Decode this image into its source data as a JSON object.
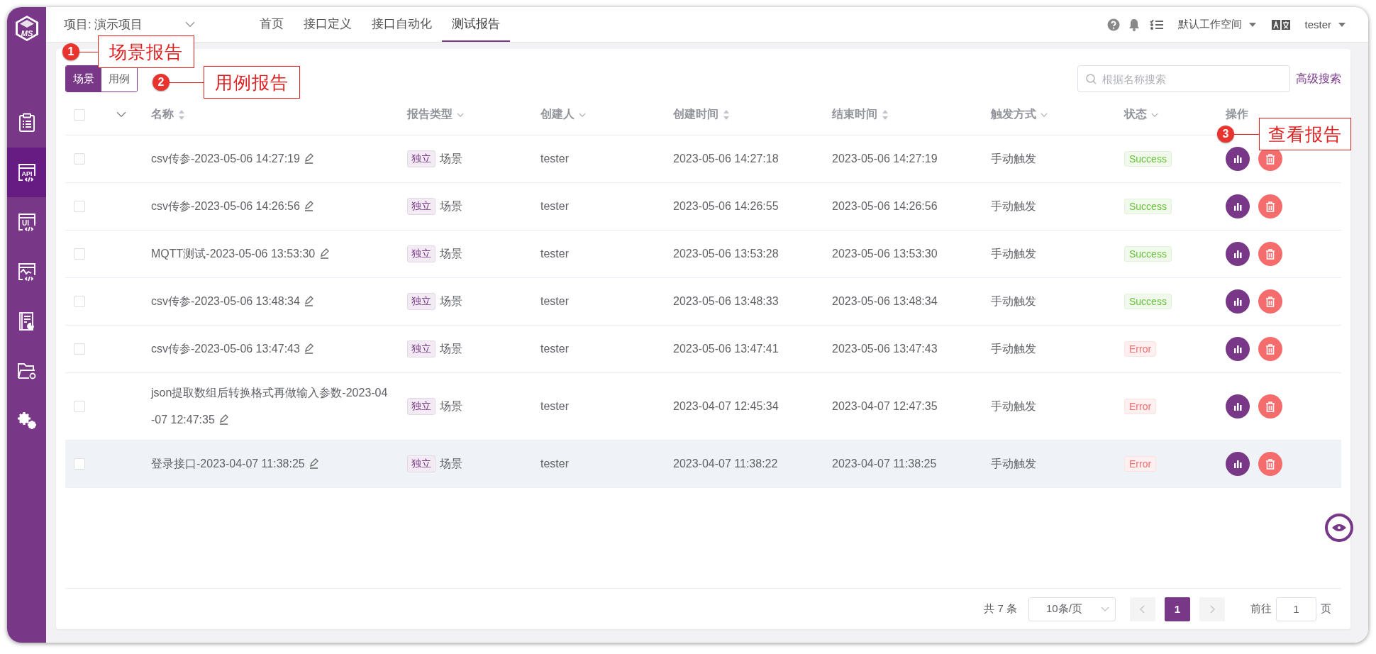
{
  "logo": {
    "text": "MS"
  },
  "sidebar": {
    "items": [
      {
        "kind": "case",
        "selected": false
      },
      {
        "kind": "api",
        "label": "API",
        "selected": true
      },
      {
        "kind": "ui",
        "label": "UI",
        "selected": false
      },
      {
        "kind": "performance",
        "selected": false
      },
      {
        "kind": "report",
        "selected": false
      },
      {
        "kind": "project",
        "selected": false
      },
      {
        "kind": "settings",
        "selected": false
      }
    ]
  },
  "header": {
    "project": "项目: 演示项目",
    "nav": [
      {
        "label": "首页",
        "selected": false
      },
      {
        "label": "接口定义",
        "selected": false
      },
      {
        "label": "接口自动化",
        "selected": false
      },
      {
        "label": "测试报告",
        "selected": true
      }
    ],
    "workspace": "默认工作空间",
    "user": "tester"
  },
  "toolbar": {
    "toggle": [
      {
        "label": "场景",
        "selected": true
      },
      {
        "label": "用例",
        "selected": false
      }
    ],
    "search": {
      "placeholder": "根据名称搜索"
    },
    "advanced_search": "高级搜索"
  },
  "table": {
    "select_all": {
      "checked": false
    },
    "columns": [
      {
        "label": "名称",
        "sortable": true,
        "filterable": false
      },
      {
        "label": "报告类型",
        "sortable": false,
        "filterable": true
      },
      {
        "label": "创建人",
        "sortable": false,
        "filterable": true
      },
      {
        "label": "创建时间",
        "sortable": true,
        "filterable": false
      },
      {
        "label": "结束时间",
        "sortable": true,
        "filterable": false
      },
      {
        "label": "触发方式",
        "sortable": false,
        "filterable": true
      },
      {
        "label": "状态",
        "sortable": false,
        "filterable": true
      },
      {
        "label": "操作",
        "sortable": false,
        "filterable": false
      }
    ],
    "rows": [
      {
        "name": "csv传参-2023-05-06 14:27:19",
        "tag": "独立",
        "type": "场景",
        "creator": "tester",
        "created": "2023-05-06 14:27:18",
        "ended": "2023-05-06 14:27:19",
        "trigger": "手动触发",
        "status": {
          "text": "Success",
          "kind": "success"
        },
        "hovered": false
      },
      {
        "name": "csv传参-2023-05-06 14:26:56",
        "tag": "独立",
        "type": "场景",
        "creator": "tester",
        "created": "2023-05-06 14:26:55",
        "ended": "2023-05-06 14:26:56",
        "trigger": "手动触发",
        "status": {
          "text": "Success",
          "kind": "success"
        },
        "hovered": false
      },
      {
        "name": "MQTT测试-2023-05-06 13:53:30",
        "tag": "独立",
        "type": "场景",
        "creator": "tester",
        "created": "2023-05-06 13:53:28",
        "ended": "2023-05-06 13:53:30",
        "trigger": "手动触发",
        "status": {
          "text": "Success",
          "kind": "success"
        },
        "hovered": false
      },
      {
        "name": "csv传参-2023-05-06 13:48:34",
        "tag": "独立",
        "type": "场景",
        "creator": "tester",
        "created": "2023-05-06 13:48:33",
        "ended": "2023-05-06 13:48:34",
        "trigger": "手动触发",
        "status": {
          "text": "Success",
          "kind": "success"
        },
        "hovered": false
      },
      {
        "name": "csv传参-2023-05-06 13:47:43",
        "tag": "独立",
        "type": "场景",
        "creator": "tester",
        "created": "2023-05-06 13:47:41",
        "ended": "2023-05-06 13:47:43",
        "trigger": "手动触发",
        "status": {
          "text": "Error",
          "kind": "error"
        },
        "hovered": false
      },
      {
        "name": "json提取数组后转换格式再做输入参数-2023-04-07 12:47:35",
        "tag": "独立",
        "type": "场景",
        "creator": "tester",
        "created": "2023-04-07 12:45:34",
        "ended": "2023-04-07 12:47:35",
        "trigger": "手动触发",
        "status": {
          "text": "Error",
          "kind": "error"
        },
        "hovered": false
      },
      {
        "name": "登录接口-2023-04-07 11:38:25",
        "tag": "独立",
        "type": "场景",
        "creator": "tester",
        "created": "2023-04-07 11:38:22",
        "ended": "2023-04-07 11:38:25",
        "trigger": "手动触发",
        "status": {
          "text": "Error",
          "kind": "error"
        },
        "hovered": true
      }
    ]
  },
  "pagination": {
    "total": "共 7 条",
    "page_size": "10条/页",
    "pages": [
      {
        "label": "1",
        "selected": true
      }
    ],
    "goto_label": "前往",
    "goto_value": "1",
    "goto_suffix": "页"
  },
  "annotations": [
    {
      "number": "1",
      "text": "场景报告"
    },
    {
      "number": "2",
      "text": "用例报告"
    },
    {
      "number": "3",
      "text": "查看报告"
    }
  ]
}
